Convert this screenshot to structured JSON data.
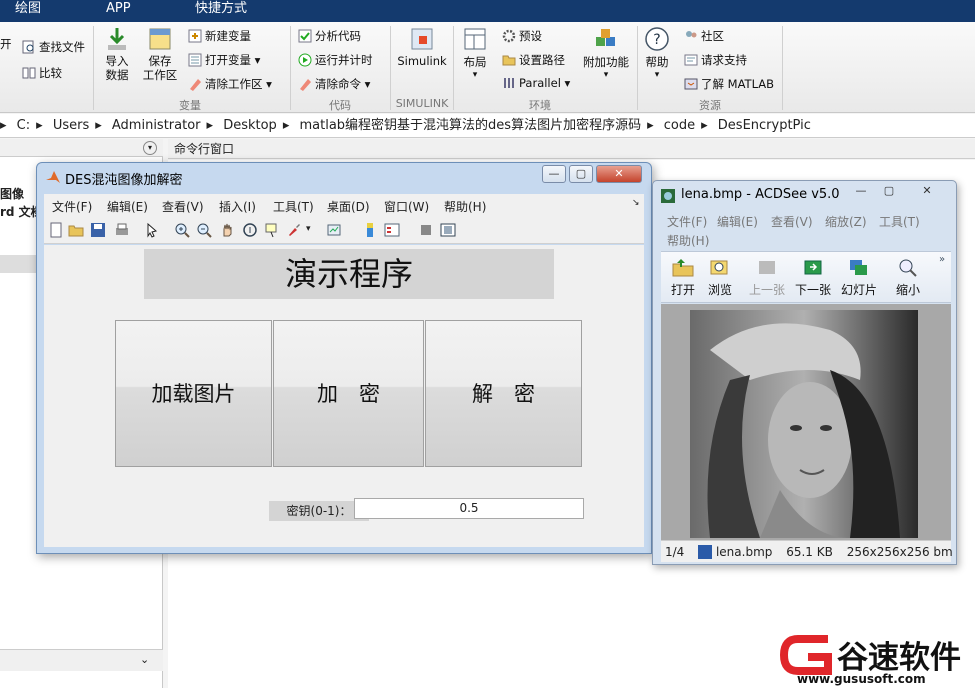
{
  "top_tabs": [
    "绘图",
    "APP",
    "快捷方式"
  ],
  "ribbon": {
    "left_items": [
      "开",
      "查找文件",
      "比较"
    ],
    "import_label": "导入\n数据",
    "save_ws_label": "保存\n工作区",
    "new_var": "新建变量",
    "open_var": "打开变量",
    "clear_ws": "清除工作区",
    "analyze_code": "分析代码",
    "run_time": "运行并计时",
    "clear_cmd": "清除命令",
    "simulink": "Simulink",
    "layout": "布局",
    "preferences": "预设",
    "set_path": "设置路径",
    "parallel": "Parallel",
    "addons": "附加功能",
    "help": "帮助",
    "community": "社区",
    "support": "请求支持",
    "learn_matlab": "了解 MATLAB",
    "groups": [
      "变量",
      "代码",
      "SIMULINK",
      "环境",
      "资源"
    ]
  },
  "address": {
    "segments": [
      "C:",
      "Users",
      "Administrator",
      "Desktop",
      "matlab编程密钥基于混沌算法的des算法图片加密程序源码",
      "code",
      "DesEncryptPic"
    ]
  },
  "left_panel": {
    "items": [
      "图像",
      "rd 文档"
    ]
  },
  "command_window": {
    "title": "命令行窗口"
  },
  "figure": {
    "title": "DES混沌图像加解密",
    "menu": [
      "文件(F)",
      "编辑(E)",
      "查看(V)",
      "插入(I)",
      "工具(T)",
      "桌面(D)",
      "窗口(W)",
      "帮助(H)"
    ],
    "demo_title": "演示程序",
    "btn_load": "加载图片",
    "btn_encrypt": "加　密",
    "btn_decrypt": "解　密",
    "key_label": "密钥(0-1)：",
    "key_value": "0.5"
  },
  "acdsee": {
    "title": "lena.bmp - ACDSee v5.0",
    "menu": [
      "文件(F)",
      "编辑(E)",
      "查看(V)",
      "缩放(Z)",
      "工具(T)",
      "帮助(H)"
    ],
    "toolbar": [
      "打开",
      "浏览",
      "上一张",
      "下一张",
      "幻灯片",
      "缩小"
    ],
    "status": {
      "index": "1/4",
      "filename": "lena.bmp",
      "size": "65.1 KB",
      "dims": "256x256x256 bm"
    }
  },
  "watermark": {
    "name": "谷速软件",
    "url": "www.gususoft.com",
    "color": "#e0262a"
  }
}
